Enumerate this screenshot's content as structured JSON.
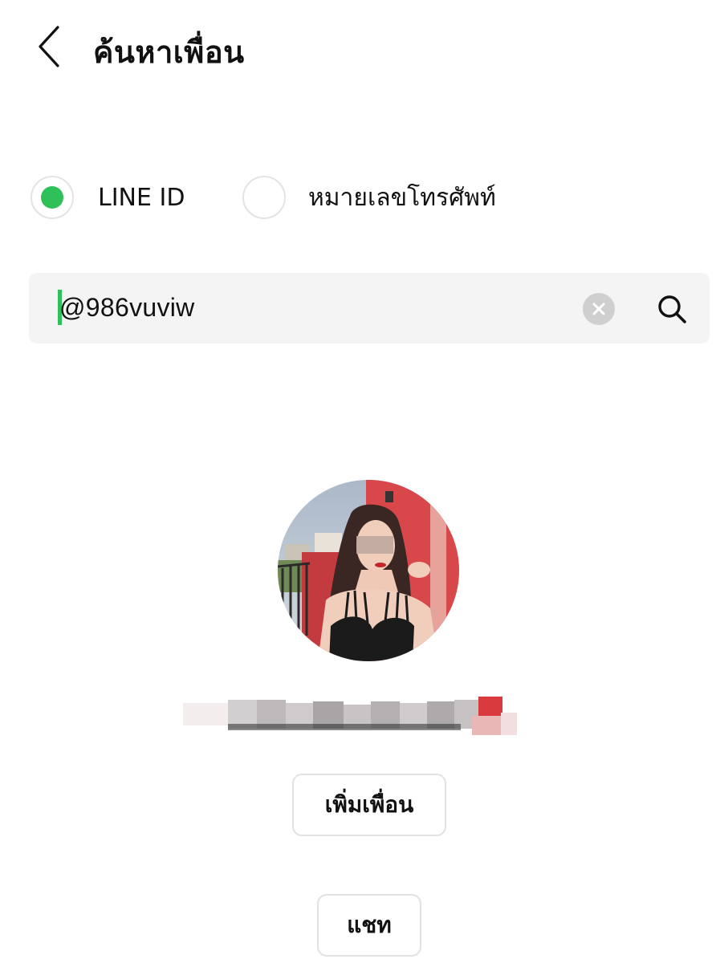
{
  "header": {
    "title": "ค้นหาเพื่อน",
    "back_icon": "chevron-left-icon"
  },
  "search_type": {
    "options": [
      {
        "label": "LINE ID",
        "selected": true
      },
      {
        "label": "หมายเลขโทรศัพท์",
        "selected": false
      }
    ],
    "selected_color": "#2fc05a"
  },
  "search": {
    "value": "@986vuviw",
    "clear_icon": "clear-icon",
    "search_icon": "search-icon"
  },
  "profile": {
    "avatar": "profile-photo"
  },
  "actions": {
    "add_friend_label": "เพิ่มเพื่อน",
    "chat_label": "แชท"
  }
}
